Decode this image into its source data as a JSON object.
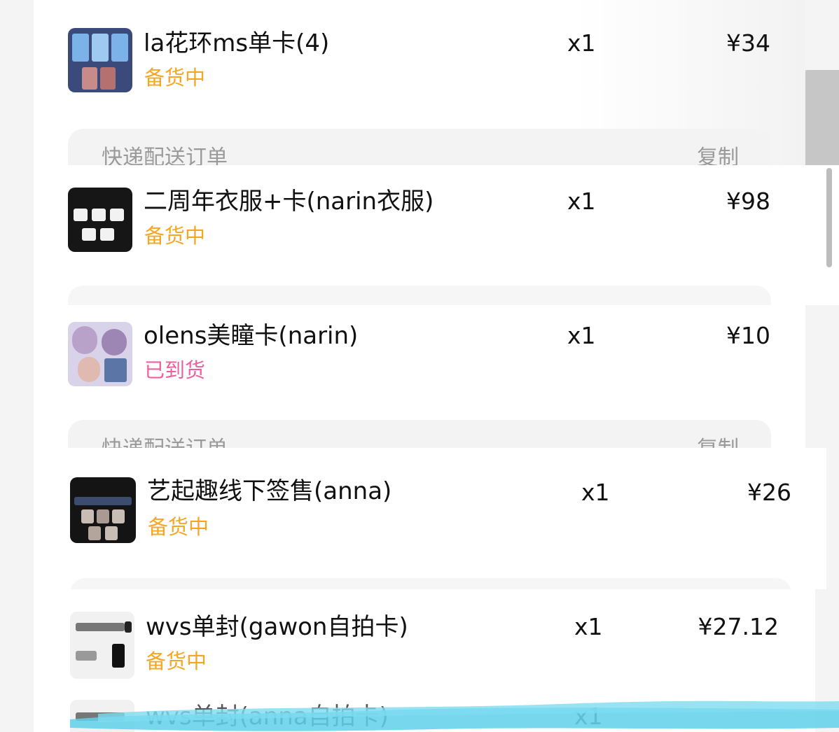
{
  "orders": [
    {
      "name": "la花环ms单卡(4)",
      "status": "备货中",
      "status_type": "stock",
      "qty": "x1",
      "price": "¥34"
    },
    {
      "name": "二周年衣服+卡(narin衣服)",
      "status": "备货中",
      "status_type": "stock",
      "qty": "x1",
      "price": "¥98"
    },
    {
      "name": "olens美瞳卡(narin)",
      "status": "已到货",
      "status_type": "arrived",
      "qty": "x1",
      "price": "¥10"
    },
    {
      "name": "艺起趣线下签售(anna)",
      "status": "备货中",
      "status_type": "stock",
      "qty": "x1",
      "price": "¥26"
    },
    {
      "name": "wvs单封(gawon自拍卡)",
      "status": "备货中",
      "status_type": "stock",
      "qty": "x1",
      "price": "¥27.12"
    },
    {
      "name": "wvs单封(anna自拍卡)",
      "qty": "x1"
    }
  ],
  "shipping": {
    "label": "快递配送订单",
    "copy": "复制"
  },
  "colors": {
    "status_stock": "#f5a623",
    "status_arrived": "#ef5fa0",
    "scribble": "#5fd0ea",
    "background": "#f4f4f4"
  },
  "icons": [
    "product-thumbnail",
    "scrollbar",
    "highlighter-scribble"
  ]
}
